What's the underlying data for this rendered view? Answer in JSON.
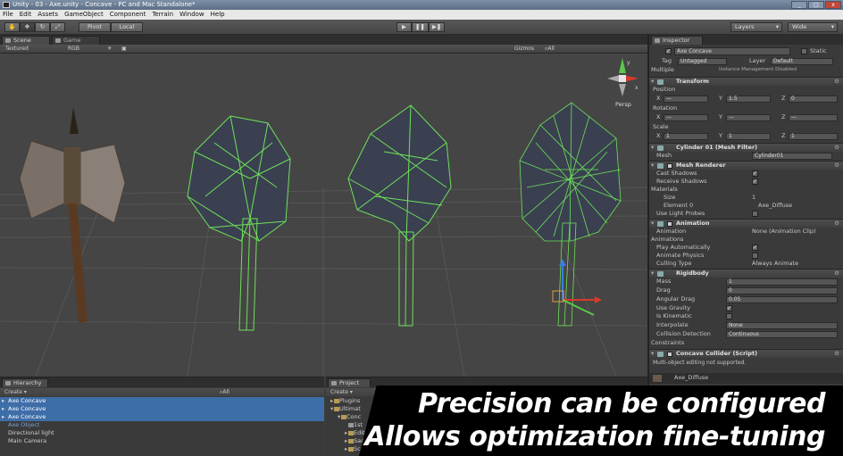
{
  "window": {
    "title": "Unity - 03 - Axe.unity - Concave - PC and Mac Standalone*",
    "controls": [
      "_",
      "□",
      "x"
    ]
  },
  "menu": [
    "File",
    "Edit",
    "Assets",
    "GameObject",
    "Component",
    "Terrain",
    "Window",
    "Help"
  ],
  "toolbar": {
    "pivot": "Pivot",
    "local": "Local",
    "play": "▶",
    "pause": "❚❚",
    "step": "▶❚",
    "layers": "Layers",
    "layout": "Wide"
  },
  "scene": {
    "tab_scene": "Scene",
    "tab_game": "Game",
    "render_mode": "Textured",
    "color_mode": "RGB",
    "gizmos": "Gizmos",
    "search": "⌕All",
    "persp": "Persp",
    "colors": {
      "wire": "#6ee05a",
      "grid": "#5a5a5a",
      "bg": "#454545"
    }
  },
  "inspector": {
    "tab": "Inspector",
    "object_name": "Axe Concave",
    "static_label": "Static",
    "tag_label": "Tag",
    "tag_value": "Untagged",
    "layer_label": "Layer",
    "layer_value": "Default",
    "multiple": "Multiple",
    "instance_note": "Instance Management Disabled",
    "transform": {
      "title": "Transform",
      "position": "Position",
      "rotation": "Rotation",
      "scale": "Scale",
      "pos": {
        "x": "—",
        "y": "1.5",
        "z": "0"
      },
      "rot": {
        "x": "—",
        "y": "—",
        "z": "—"
      },
      "scl": {
        "x": "1",
        "y": "1",
        "z": "1"
      },
      "axis": {
        "x": "X",
        "y": "Y",
        "z": "Z"
      }
    },
    "mesh_filter": {
      "title": "Cylinder 01 (Mesh Filter)",
      "mesh_label": "Mesh",
      "mesh_value": "Cylinder01"
    },
    "mesh_renderer": {
      "title": "Mesh Renderer",
      "cast_shadows": "Cast Shadows",
      "receive_shadows": "Receive Shadows",
      "materials": "Materials",
      "size_label": "Size",
      "size_value": "1",
      "element0_label": "Element 0",
      "element0_value": "Axe_Diffuse",
      "light_probes": "Use Light Probes"
    },
    "animation": {
      "title": "Animation",
      "animation_label": "Animation",
      "animation_value": "None (Animation Clip)",
      "animations": "Animations",
      "play_auto": "Play Automatically",
      "animate_physics": "Animate Physics",
      "culling_label": "Culling Type",
      "culling_value": "Always Animate"
    },
    "rigidbody": {
      "title": "Rigidbody",
      "mass_label": "Mass",
      "mass_value": "1",
      "drag_label": "Drag",
      "drag_value": "0",
      "angular_label": "Angular Drag",
      "angular_value": "0.05",
      "gravity": "Use Gravity",
      "kinematic": "Is Kinematic",
      "interp_label": "Interpolate",
      "interp_value": "None",
      "collision_label": "Collision Detection",
      "collision_value": "Continuous",
      "constraints": "Constraints"
    },
    "concave": {
      "title": "Concave Collider (Script)",
      "note": "Multi-object editing not supported."
    },
    "material_preview": "Axe_Diffuse"
  },
  "hierarchy": {
    "tab": "Hierarchy",
    "create": "Create ▾",
    "search": "⌕All",
    "items": [
      {
        "label": "Axe Concave",
        "selected": true
      },
      {
        "label": "Axe Concave",
        "selected": true
      },
      {
        "label": "Axe Concave",
        "selected": true
      },
      {
        "label": "Axe Object",
        "selected": false
      },
      {
        "label": "Directional light",
        "selected": false
      },
      {
        "label": "Main Camera",
        "selected": false
      }
    ]
  },
  "project": {
    "tab": "Project",
    "create": "Create ▾",
    "items": [
      "Plugins",
      "Ultimat",
      "Conc",
      "1st",
      "Edit",
      "Sam",
      "Scrip"
    ]
  },
  "overlay": {
    "line1": "Precision can be configured",
    "line2": "Allows optimization fine-tuning"
  }
}
